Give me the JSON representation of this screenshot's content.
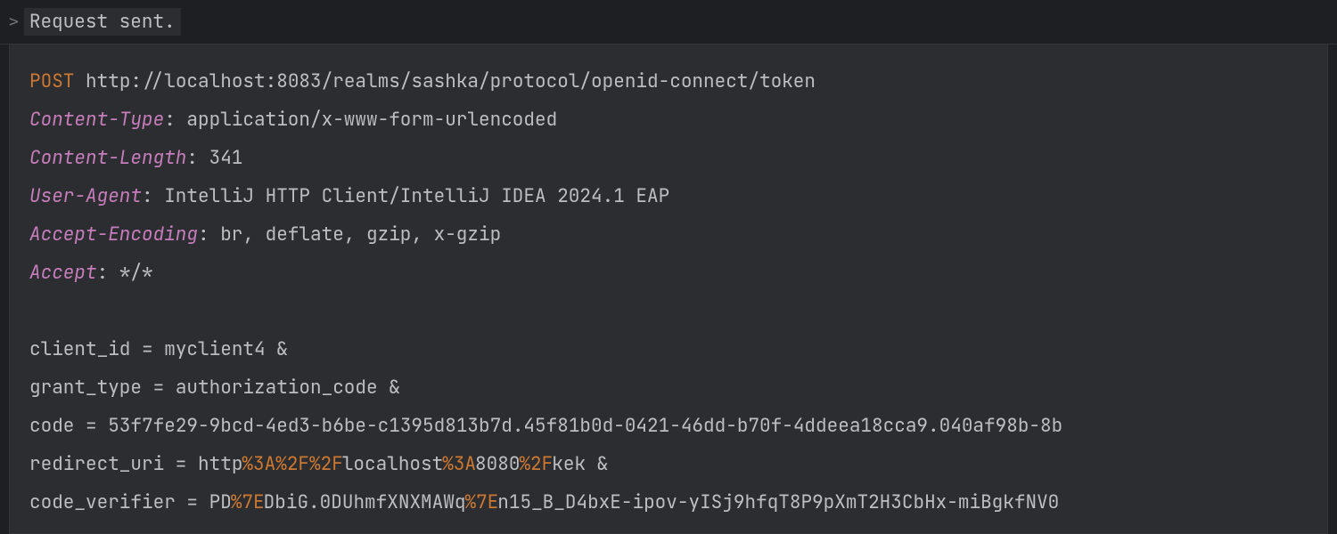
{
  "status": "Request sent.",
  "request": {
    "method": "POST",
    "url": "http://localhost:8083/realms/sashka/protocol/openid-connect/token",
    "headers": [
      {
        "name": "Content-Type",
        "value": "application/x-www-form-urlencoded"
      },
      {
        "name": "Content-Length",
        "value": "341"
      },
      {
        "name": "User-Agent",
        "value": "IntelliJ HTTP Client/IntelliJ IDEA 2024.1 EAP"
      },
      {
        "name": "Accept-Encoding",
        "value": "br, deflate, gzip, x-gzip"
      },
      {
        "name": "Accept",
        "value": "*/*"
      }
    ],
    "body": [
      {
        "key": "client_id",
        "raw": "myclient4",
        "segments": [
          [
            "t",
            "myclient4"
          ]
        ]
      },
      {
        "key": "grant_type",
        "raw": "authorization_code",
        "segments": [
          [
            "t",
            "authorization_code"
          ]
        ]
      },
      {
        "key": "code",
        "raw": "53f7fe29-9bcd-4ed3-b6be-c1395d813b7d.45f81b0d-0421-46dd-b70f-4ddeea18cca9.040af98b-8b",
        "segments": [
          [
            "t",
            "53f7fe29-9bcd-4ed3-b6be-c1395d813b7d.45f81b0d-0421-46dd-b70f-4ddeea18cca9.040af98b-8b"
          ]
        ]
      },
      {
        "key": "redirect_uri",
        "raw": "http%3A%2F%2Flocalhost%3A8080%2Fkek",
        "segments": [
          [
            "t",
            "http"
          ],
          [
            "e",
            "%3A%2F%2F"
          ],
          [
            "t",
            "localhost"
          ],
          [
            "e",
            "%3A"
          ],
          [
            "t",
            "8080"
          ],
          [
            "e",
            "%2F"
          ],
          [
            "t",
            "kek"
          ]
        ]
      },
      {
        "key": "code_verifier",
        "raw": "PD%7EDbiG.0DUhmfXNXMAWq%7En15_B_D4bxE-ipov-yISj9hfqT8P9pXmT2H3CbHx-miBgkfNV0",
        "segments": [
          [
            "t",
            "PD"
          ],
          [
            "e",
            "%7E"
          ],
          [
            "t",
            "DbiG.0DUhmfXNXMAWq"
          ],
          [
            "e",
            "%7E"
          ],
          [
            "t",
            "n15_B_D4bxE-ipov-yISj9hfqT8P9pXmT2H3CbHx-miBgkfNV0"
          ]
        ]
      }
    ]
  }
}
